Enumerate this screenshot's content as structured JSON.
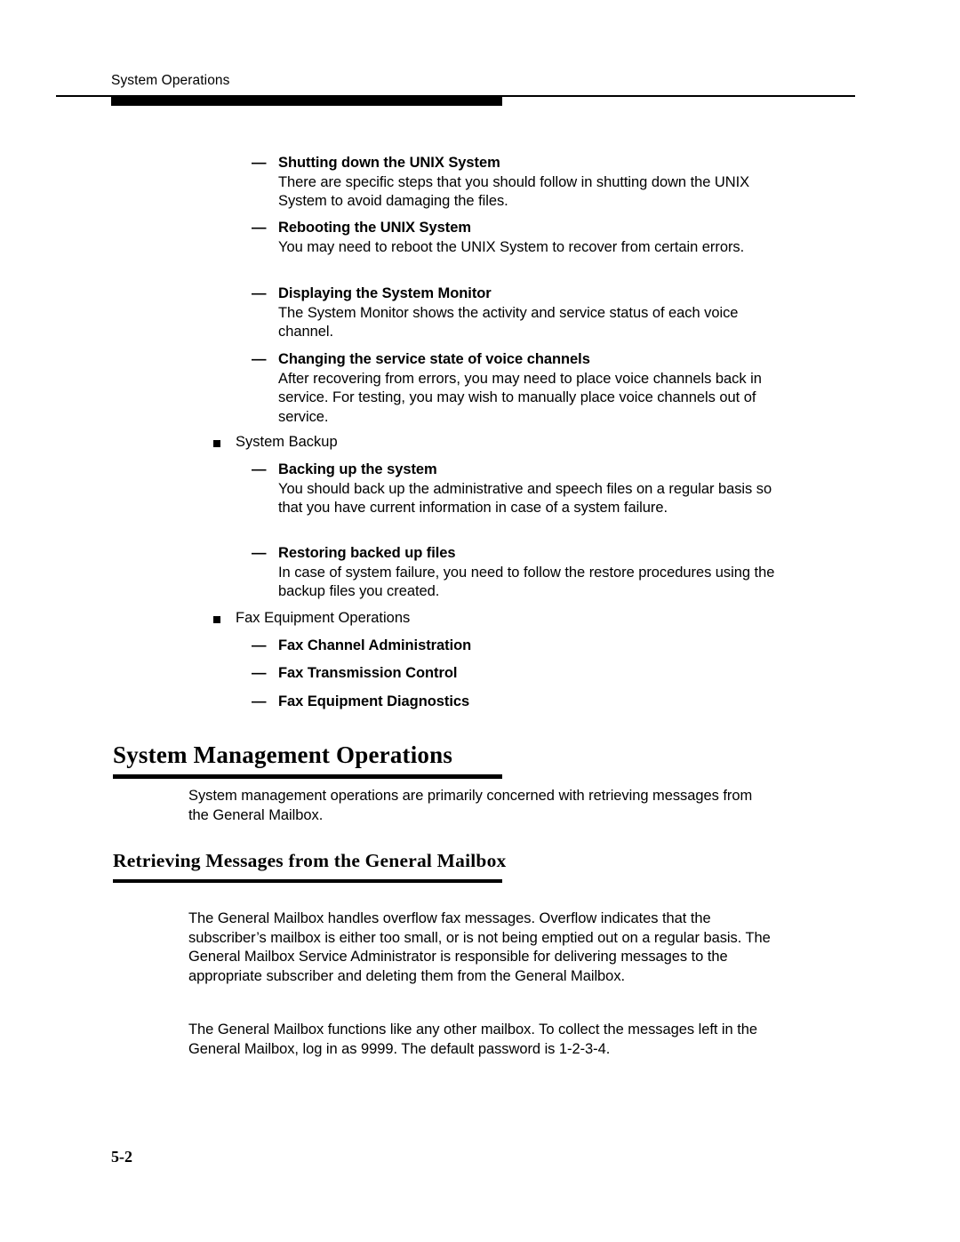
{
  "header": {
    "running_title": "System Operations"
  },
  "outline": {
    "dash_items_top": [
      {
        "mark": "—",
        "title": "Shutting down the UNIX System",
        "body": "There are specific steps that you should follow in shutting down the UNIX System to avoid damaging the files."
      },
      {
        "mark": "—",
        "title": "Rebooting the UNIX System",
        "body": "You may need to reboot the UNIX System to recover from certain errors."
      },
      {
        "mark": "—",
        "title": "Displaying the System Monitor",
        "body": "The System Monitor shows the activity and service status of each voice channel."
      },
      {
        "mark": "—",
        "title": "Changing the service state of voice channels",
        "body": "After recovering from errors, you may need to place voice channels back in service.  For testing, you may wish to manually place voice channels out of service."
      }
    ],
    "system_backup": {
      "label": "System Backup",
      "dash_items": [
        {
          "mark": "—",
          "title": "Backing up the system",
          "body": "You should back up the administrative and speech files on a regular basis so that you have current information in case of a system failure."
        },
        {
          "mark": "—",
          "title": "Restoring backed up files",
          "body": "In case of system failure, you need to follow the restore procedures using the backup files you created."
        }
      ]
    },
    "fax_equipment": {
      "label": "Fax Equipment Operations",
      "dash_items": [
        {
          "mark": "—",
          "title": "Fax Channel Administration"
        },
        {
          "mark": "—",
          "title": "Fax Transmission Control"
        },
        {
          "mark": "—",
          "title": "Fax Equipment Diagnostics"
        }
      ]
    }
  },
  "sections": {
    "system_management": {
      "heading": "System Management Operations",
      "intro": "System management operations are primarily concerned with retrieving messages from the General Mailbox."
    },
    "retrieving_messages": {
      "heading": "Retrieving Messages from the General Mailbox",
      "paragraph_1": "The General Mailbox handles overflow fax messages.  Overflow indicates that the subscriber’s mailbox is either too small, or is not being emptied out on a regular basis.  The General Mailbox Service Administrator is responsible for delivering messages to the appropriate subscriber and deleting them from the General Mailbox.",
      "paragraph_2": "The General Mailbox functions like any other mailbox.  To collect the messages left in the General Mailbox, log in as 9999.  The default password is 1-2-3-4."
    }
  },
  "footer": {
    "page_number": "5-2"
  }
}
